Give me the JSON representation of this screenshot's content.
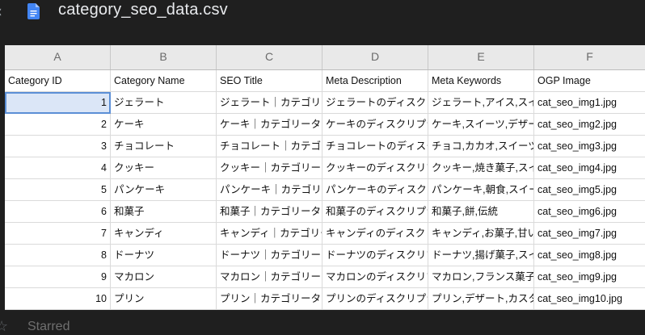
{
  "window": {
    "nav_glyph": "‹",
    "title": "category_seo_data.csv",
    "file_icon": "google-docs-icon",
    "accent": "#4285f4"
  },
  "sheet": {
    "columns": [
      "A",
      "B",
      "C",
      "D",
      "E",
      "F"
    ],
    "header": [
      "Category ID",
      "Category Name",
      "SEO Title",
      "Meta Description",
      "Meta Keywords",
      "OGP Image"
    ],
    "rows": [
      [
        "1",
        "ジェラート",
        "ジェラート｜カテゴリーペ",
        "ジェラートのディスクリプシ",
        "ジェラート,アイス,スイーツ",
        "cat_seo_img1.jpg"
      ],
      [
        "2",
        "ケーキ",
        "ケーキ｜カテゴリータイトル",
        "ケーキのディスクリプション",
        "ケーキ,スイーツ,デザート",
        "cat_seo_img2.jpg"
      ],
      [
        "3",
        "チョコレート",
        "チョコレート｜カテゴリー",
        "チョコレートのディスクリプ",
        "チョコ,カカオ,スイーツ",
        "cat_seo_img3.jpg"
      ],
      [
        "4",
        "クッキー",
        "クッキー｜カテゴリータイ",
        "クッキーのディスクリプショ",
        "クッキー,焼き菓子,スイーツ",
        "cat_seo_img4.jpg"
      ],
      [
        "5",
        "パンケーキ",
        "パンケーキ｜カテゴリー",
        "パンケーキのディスクリプ",
        "パンケーキ,朝食,スイーツ",
        "cat_seo_img5.jpg"
      ],
      [
        "6",
        "和菓子",
        "和菓子｜カテゴリータイト",
        "和菓子のディスクリプション",
        "和菓子,餅,伝統",
        "cat_seo_img6.jpg"
      ],
      [
        "7",
        "キャンディ",
        "キャンディ｜カテゴリー",
        "キャンディのディスクリプ",
        "キャンディ,お菓子,甘い",
        "cat_seo_img7.jpg"
      ],
      [
        "8",
        "ドーナツ",
        "ドーナツ｜カテゴリータイ",
        "ドーナツのディスクリプショ",
        "ドーナツ,揚げ菓子,スイーツ",
        "cat_seo_img8.jpg"
      ],
      [
        "9",
        "マカロン",
        "マカロン｜カテゴリータイ",
        "マカロンのディスクリプショ",
        "マカロン,フランス菓子,スイーツ",
        "cat_seo_img9.jpg"
      ],
      [
        "10",
        "プリン",
        "プリン｜カテゴリータイトル",
        "プリンのディスクリプション",
        "プリン,デザート,カスタード",
        "cat_seo_img10.jpg"
      ]
    ]
  },
  "footer": {
    "star_icon": "star-icon",
    "starred_label": "Starred"
  }
}
